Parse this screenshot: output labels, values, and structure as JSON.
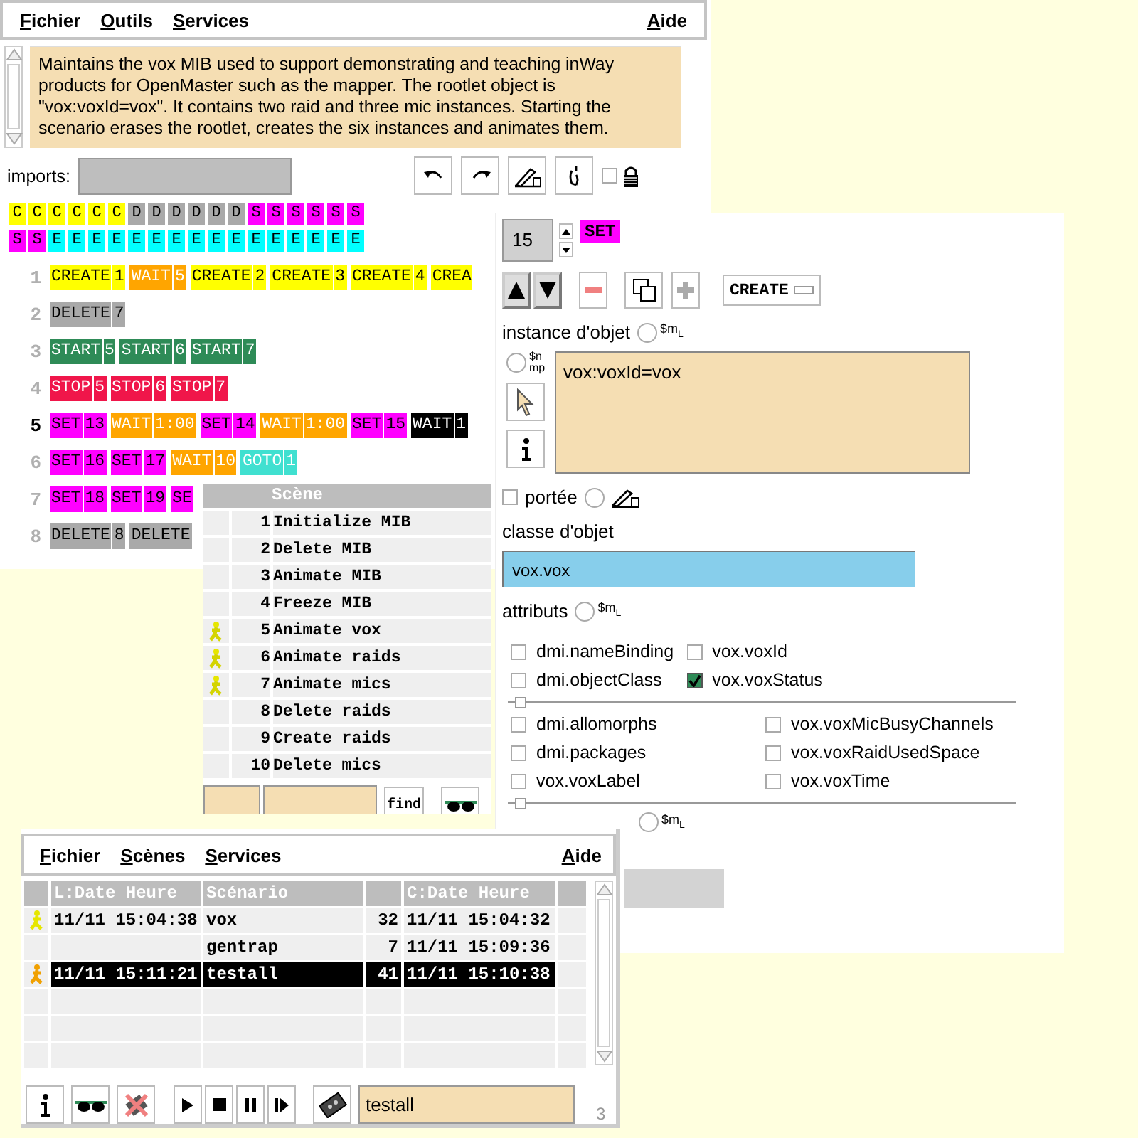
{
  "editor": {
    "menu": [
      "Fichier",
      "Outils",
      "Services"
    ],
    "help_menu": "Aide",
    "description": "Maintains the vox MIB used to support demonstrating and teaching inWay products for OpenMaster such as the mapper. The rootlet object is \"vox:voxId=vox\". It contains two raid and three mic instances. Starting the scenario erases the rootlet, creates the six instances and animates them.",
    "imports_label": "imports:",
    "lock": {
      "checked": false
    },
    "tiles": [
      [
        {
          "letter": "C",
          "color": "#ffff00"
        },
        {
          "letter": "C",
          "color": "#ffff00"
        },
        {
          "letter": "C",
          "color": "#ffff00"
        },
        {
          "letter": "C",
          "color": "#ffff00"
        },
        {
          "letter": "C",
          "color": "#ffff00"
        },
        {
          "letter": "C",
          "color": "#ffff00"
        },
        {
          "letter": "D",
          "color": "#a9a9a9"
        },
        {
          "letter": "D",
          "color": "#a9a9a9"
        },
        {
          "letter": "D",
          "color": "#a9a9a9"
        },
        {
          "letter": "D",
          "color": "#a9a9a9"
        },
        {
          "letter": "D",
          "color": "#a9a9a9"
        },
        {
          "letter": "D",
          "color": "#a9a9a9"
        },
        {
          "letter": "S",
          "color": "#ff00ff"
        },
        {
          "letter": "S",
          "color": "#ff00ff"
        },
        {
          "letter": "S",
          "color": "#ff00ff"
        },
        {
          "letter": "S",
          "color": "#ff00ff"
        },
        {
          "letter": "S",
          "color": "#ff00ff"
        },
        {
          "letter": "S",
          "color": "#ff00ff"
        }
      ],
      [
        {
          "letter": "S",
          "color": "#ff00ff"
        },
        {
          "letter": "S",
          "color": "#ff00ff"
        },
        {
          "letter": "E",
          "color": "#00ffff"
        },
        {
          "letter": "E",
          "color": "#00ffff"
        },
        {
          "letter": "E",
          "color": "#00ffff"
        },
        {
          "letter": "E",
          "color": "#00ffff"
        },
        {
          "letter": "E",
          "color": "#00ffff"
        },
        {
          "letter": "E",
          "color": "#00ffff"
        },
        {
          "letter": "E",
          "color": "#00ffff"
        },
        {
          "letter": "E",
          "color": "#00ffff"
        },
        {
          "letter": "E",
          "color": "#00ffff"
        },
        {
          "letter": "E",
          "color": "#00ffff"
        },
        {
          "letter": "E",
          "color": "#00ffff"
        },
        {
          "letter": "E",
          "color": "#00ffff"
        },
        {
          "letter": "E",
          "color": "#00ffff"
        },
        {
          "letter": "E",
          "color": "#00ffff"
        },
        {
          "letter": "E",
          "color": "#00ffff"
        },
        {
          "letter": "E",
          "color": "#00ffff"
        }
      ]
    ],
    "lines": [
      {
        "number": "1",
        "current": false,
        "commands": [
          {
            "op": "CREATE",
            "arg": "1",
            "color": "#ffff00",
            "inverse": false
          },
          {
            "op": "WAIT",
            "arg": "5",
            "color": "#ffa500",
            "inverse": true
          },
          {
            "op": "CREATE",
            "arg": "2",
            "color": "#ffff00",
            "inverse": false
          },
          {
            "op": "CREATE",
            "arg": "3",
            "color": "#ffff00",
            "inverse": false
          },
          {
            "op": "CREATE",
            "arg": "4",
            "color": "#ffff00",
            "inverse": false
          },
          {
            "op": "CREA",
            "color": "#ffff00",
            "inverse": false
          }
        ]
      },
      {
        "number": "2",
        "current": false,
        "commands": [
          {
            "op": "DELETE",
            "arg": "7",
            "color": "#a9a9a9",
            "inverse": false
          }
        ]
      },
      {
        "number": "3",
        "current": false,
        "commands": [
          {
            "op": "START",
            "arg": "5",
            "color": "#2e8b57",
            "inverse": true
          },
          {
            "op": "START",
            "arg": "6",
            "color": "#2e8b57",
            "inverse": true
          },
          {
            "op": "START",
            "arg": "7",
            "color": "#2e8b57",
            "inverse": true
          }
        ]
      },
      {
        "number": "4",
        "current": false,
        "commands": [
          {
            "op": "STOP",
            "arg": "5",
            "color": "#f0164a",
            "inverse": true
          },
          {
            "op": "STOP",
            "arg": "6",
            "color": "#f0164a",
            "inverse": true
          },
          {
            "op": "STOP",
            "arg": "7",
            "color": "#f0164a",
            "inverse": true
          }
        ]
      },
      {
        "number": "5",
        "current": true,
        "commands": [
          {
            "op": "SET",
            "arg": "13",
            "color": "#ff00ff",
            "inverse": false
          },
          {
            "op": "WAIT",
            "arg": "1:00",
            "color": "#ffa500",
            "inverse": true
          },
          {
            "op": "SET",
            "arg": "14",
            "color": "#ff00ff",
            "inverse": false
          },
          {
            "op": "WAIT",
            "arg": "1:00",
            "color": "#ffa500",
            "inverse": true
          },
          {
            "op": "SET",
            "arg": "15",
            "color": "#ff00ff",
            "inverse": false
          },
          {
            "op": "WAIT",
            "arg": "1",
            "color": "#000000",
            "inverse": true
          }
        ]
      },
      {
        "number": "6",
        "current": false,
        "commands": [
          {
            "op": "SET",
            "arg": "16",
            "color": "#ff00ff",
            "inverse": false
          },
          {
            "op": "SET",
            "arg": "17",
            "color": "#ff00ff",
            "inverse": false
          },
          {
            "op": "WAIT",
            "arg": "10",
            "color": "#ffa500",
            "inverse": true
          },
          {
            "op": "GOTO",
            "arg": "1",
            "color": "#40e0d0",
            "inverse": true
          }
        ]
      },
      {
        "number": "7",
        "current": false,
        "commands": [
          {
            "op": "SET",
            "arg": "18",
            "color": "#ff00ff",
            "inverse": false
          },
          {
            "op": "SET",
            "arg": "19",
            "color": "#ff00ff",
            "inverse": false
          },
          {
            "op": "SE",
            "color": "#ff00ff",
            "inverse": false
          }
        ]
      },
      {
        "number": "8",
        "current": false,
        "commands": [
          {
            "op": "DELETE",
            "arg": "8",
            "color": "#a9a9a9",
            "inverse": false
          },
          {
            "op": "DELETE",
            "color": "#a9a9a9",
            "inverse": false
          }
        ]
      }
    ]
  },
  "properties": {
    "spinner_value": "15",
    "command_tag": {
      "text": "SET",
      "color": "#ff00ff"
    },
    "tool_buttons": [
      {
        "kind": "up",
        "disabled": false
      },
      {
        "kind": "down",
        "disabled": false
      },
      {
        "kind": "remove",
        "disabled": false
      },
      {
        "kind": "copy",
        "disabled": false
      },
      {
        "kind": "add",
        "disabled": true
      }
    ],
    "command_menu": "CREATE",
    "instance_label": "instance d'objet",
    "instance_mode": {
      "main": "$m",
      "sub": "L",
      "selected": false
    },
    "name_mode": {
      "top": "$n",
      "bottom": "mp",
      "selected": false
    },
    "instance_value": "vox:voxId=vox",
    "scope": {
      "label": "portée",
      "checked": false
    },
    "scope_radio": {
      "selected": false
    },
    "class_label": "classe d'objet",
    "class_value": "vox.vox",
    "attributes_label": "attributs",
    "attributes_mode": {
      "main": "$m",
      "sub": "L",
      "selected": false
    },
    "attribute_groups": [
      [
        {
          "name": "dmi.nameBinding",
          "checked": false
        },
        {
          "name": "vox.voxId",
          "checked": false
        },
        {
          "name": "dmi.objectClass",
          "checked": false
        },
        {
          "name": "vox.voxStatus",
          "checked": true
        }
      ],
      [
        {
          "name": "dmi.allomorphs",
          "checked": false
        },
        {
          "name": "vox.voxMicBusyChannels",
          "checked": false
        },
        {
          "name": "dmi.packages",
          "checked": false
        },
        {
          "name": "vox.voxRaidUsedSpace",
          "checked": false
        },
        {
          "name": "vox.voxLabel",
          "checked": false
        },
        {
          "name": "vox.voxTime",
          "checked": false
        }
      ]
    ],
    "bottom_mode": {
      "main": "$m",
      "sub": "L",
      "selected": false
    }
  },
  "scenes": {
    "header": "Scène",
    "rows": [
      {
        "number": "1",
        "name": "Initialize MIB",
        "running": false
      },
      {
        "number": "2",
        "name": "Delete MIB",
        "running": false
      },
      {
        "number": "3",
        "name": "Animate MIB",
        "running": false
      },
      {
        "number": "4",
        "name": "Freeze MIB",
        "running": false
      },
      {
        "number": "5",
        "name": "Animate vox",
        "running": true
      },
      {
        "number": "6",
        "name": "Animate raids",
        "running": true
      },
      {
        "number": "7",
        "name": "Animate mics",
        "running": true
      },
      {
        "number": "8",
        "name": "Delete raids",
        "running": false
      },
      {
        "number": "9",
        "name": "Create raids",
        "running": false
      },
      {
        "number": "10",
        "name": "Delete mics",
        "running": false
      }
    ],
    "find_button": "find"
  },
  "scenarios": {
    "menu": [
      "Fichier",
      "Scènes",
      "Services"
    ],
    "help_menu": "Aide",
    "columns": {
      "started": "L:Date Heure",
      "name": "Scénario",
      "created": "C:Date Heure"
    },
    "rows": [
      {
        "running": true,
        "started": "11/11 15:04:38",
        "name": "vox",
        "count": "32",
        "created": "11/11 15:04:32",
        "selected": false
      },
      {
        "running": false,
        "name": "gentrap",
        "count": "7",
        "created": "11/11 15:09:36",
        "selected": false
      },
      {
        "running": true,
        "started": "11/11 15:11:21",
        "name": "testall",
        "count": "41",
        "created": "11/11 15:10:38",
        "selected": true
      },
      {
        "running": false,
        "selected": false
      },
      {
        "running": false,
        "selected": false
      },
      {
        "running": false,
        "selected": false
      }
    ],
    "search_value": "testall",
    "counter": "3"
  }
}
